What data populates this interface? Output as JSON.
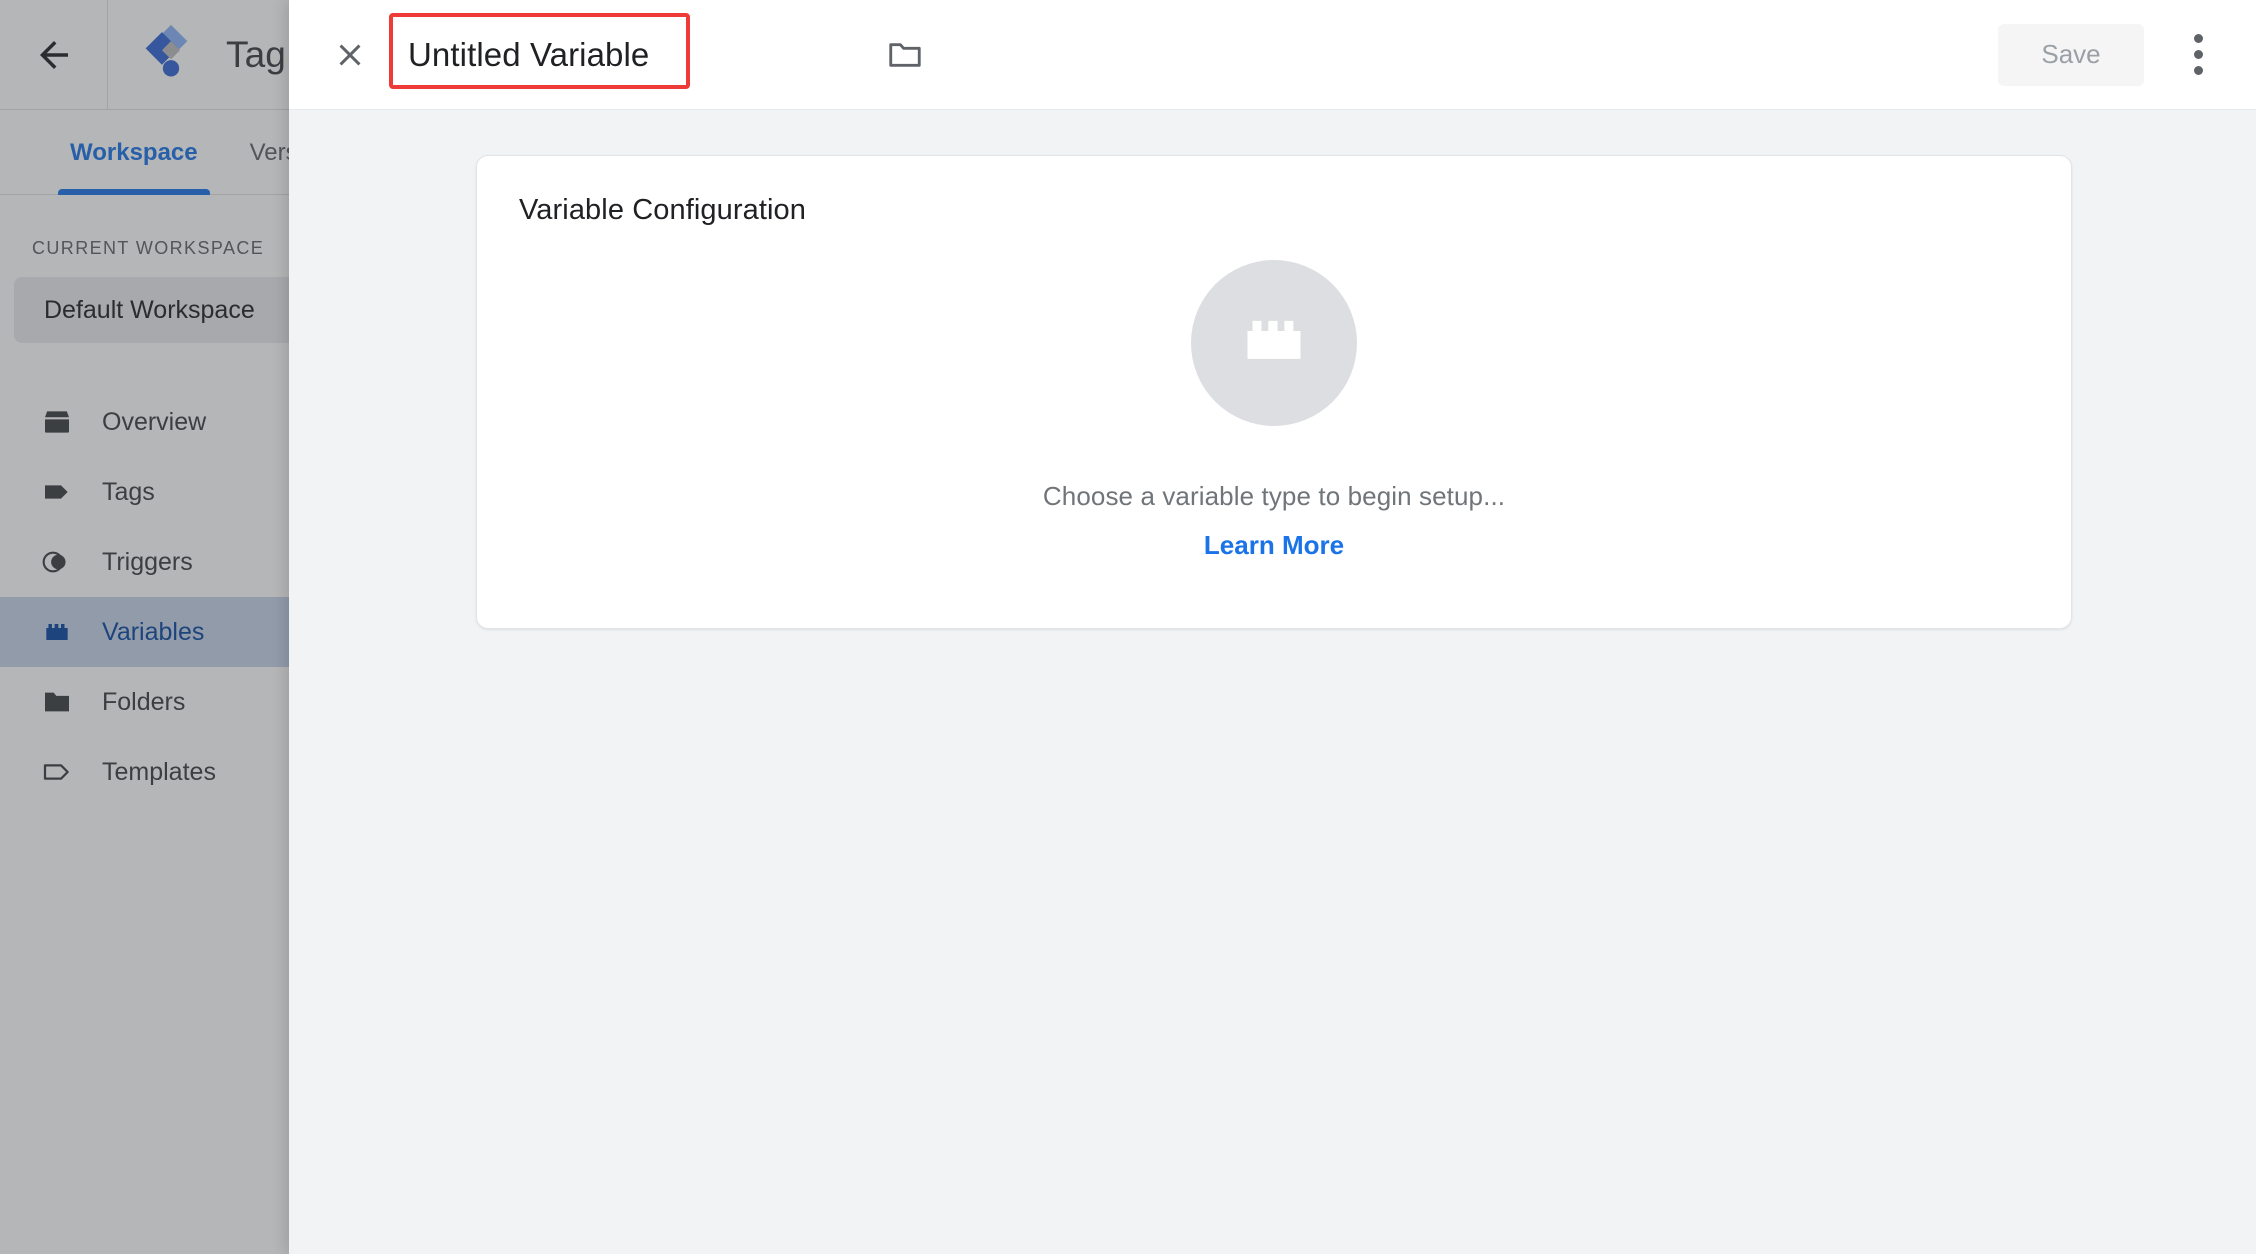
{
  "background_app": {
    "back_icon": "back-arrow-icon",
    "logo_icon": "tag-manager-logo-icon",
    "brand_title": "Tag Ma",
    "tabs": [
      {
        "label": "Workspace",
        "active": true
      },
      {
        "label": "Versi",
        "active": false
      }
    ],
    "sidebar": {
      "section_label": "CURRENT WORKSPACE",
      "workspace_name": "Default Workspace",
      "items": [
        {
          "label": "Overview",
          "icon": "overview-box-icon",
          "selected": false
        },
        {
          "label": "Tags",
          "icon": "tag-filled-icon",
          "selected": false
        },
        {
          "label": "Triggers",
          "icon": "trigger-circles-icon",
          "selected": false
        },
        {
          "label": "Variables",
          "icon": "variable-brick-icon",
          "selected": true
        },
        {
          "label": "Folders",
          "icon": "folder-filled-icon",
          "selected": false
        },
        {
          "label": "Templates",
          "icon": "template-tag-outline-icon",
          "selected": false
        }
      ]
    }
  },
  "panel": {
    "close_icon": "close-icon",
    "title_value": "Untitled Variable",
    "title_placeholder": "Untitled Variable",
    "folder_icon": "folder-outline-icon",
    "save_label": "Save",
    "save_disabled": true,
    "more_icon": "more-vert-icon",
    "highlight_color": "#ef3b38"
  },
  "card": {
    "title": "Variable Configuration",
    "empty_state": {
      "icon": "variable-brick-icon",
      "message": "Choose a variable type to begin setup...",
      "link_label": "Learn More",
      "link_color": "#1a73e8"
    }
  }
}
